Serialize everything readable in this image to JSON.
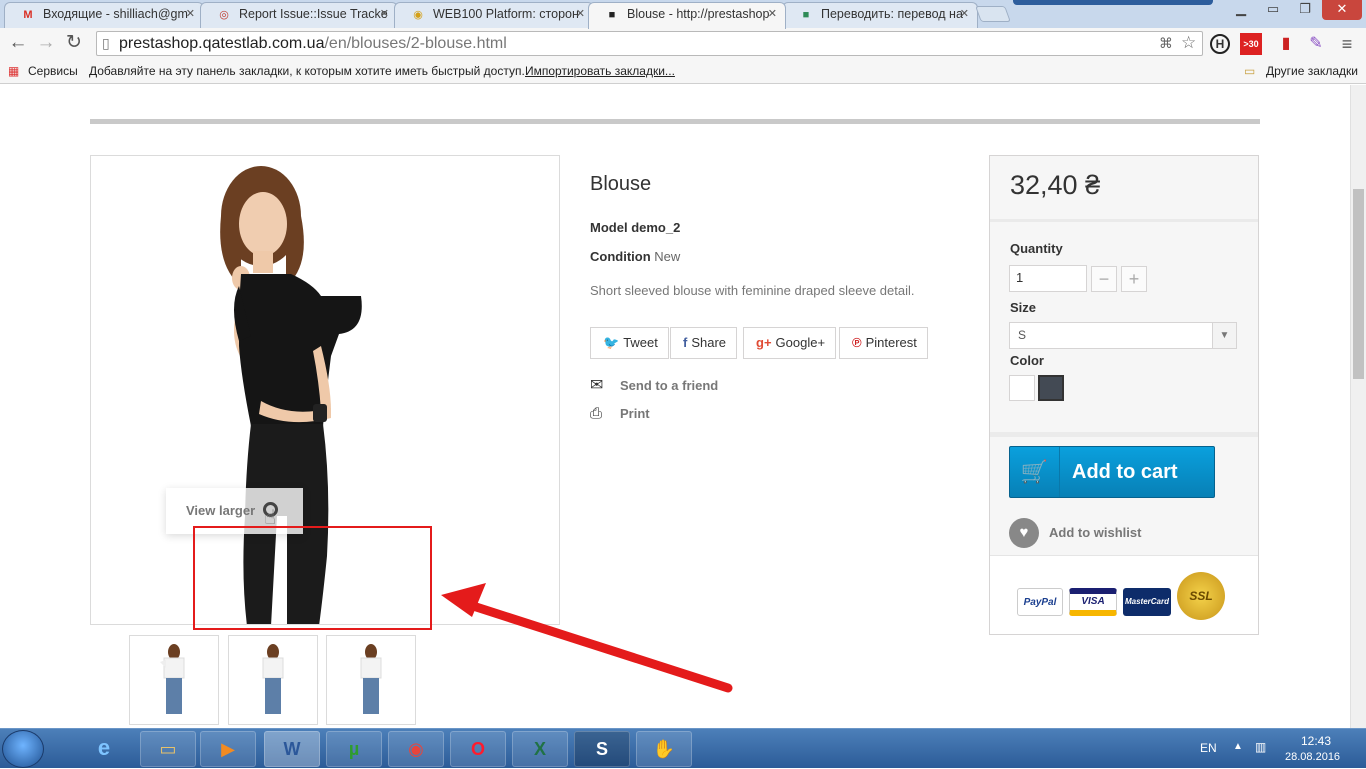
{
  "browser": {
    "tabs": [
      {
        "title": "Входящие - shilliach@gm",
        "icon": "gmail-icon",
        "fav_text": "M",
        "fav_color": "#d93025"
      },
      {
        "title": "Report Issue::Issue Tracke",
        "icon": "tracker-icon",
        "fav_text": "◎",
        "fav_color": "#c0392b"
      },
      {
        "title": "WEB100 Platform: сторон",
        "icon": "web100-icon",
        "fav_text": "◉",
        "fav_color": "#d4a017"
      },
      {
        "title": "Blouse - http://prestashop",
        "icon": "prestashop-icon",
        "fav_text": "■",
        "fav_color": "#222222"
      },
      {
        "title": "Переводить: перевод на",
        "icon": "translate-icon",
        "fav_text": "■",
        "fav_color": "#2e8b57"
      }
    ],
    "address": {
      "host": "prestashop.qatestlab.com.ua",
      "path": "/en/blouses/2-blouse.html"
    },
    "bookmarks": {
      "apps": "Сервисы",
      "hint": "Добавляйте на эту панель закладки, к которым хотите иметь быстрый доступ.",
      "import_link": "Импортировать закладки...",
      "other": "Другие закладки"
    }
  },
  "product": {
    "title": "Blouse",
    "model_label": "Model",
    "model_value": "demo_2",
    "condition_label": "Condition",
    "condition_value": "New",
    "description": "Short sleeved blouse with feminine draped sleeve detail.",
    "view_larger": "View larger",
    "social": {
      "tweet": "Tweet",
      "share": "Share",
      "google": "Google+",
      "pinterest": "Pinterest"
    },
    "send_to_friend": "Send to a friend",
    "print": "Print"
  },
  "buybox": {
    "price": "32,40 ₴",
    "quantity_label": "Quantity",
    "quantity_value": "1",
    "size_label": "Size",
    "size_value": "S",
    "color_label": "Color",
    "colors": [
      "#ffffff",
      "#434a54"
    ],
    "add_to_cart": "Add to cart",
    "add_to_wishlist": "Add to wishlist",
    "payments": [
      "PayPal",
      "VISA",
      "MasterCard",
      "SSL"
    ]
  },
  "taskbar": {
    "lang": "EN",
    "time": "12:43",
    "date": "28.08.2016"
  },
  "colors": {
    "accent_blue": "#0780b6",
    "annotation_red": "#e41b1b"
  }
}
